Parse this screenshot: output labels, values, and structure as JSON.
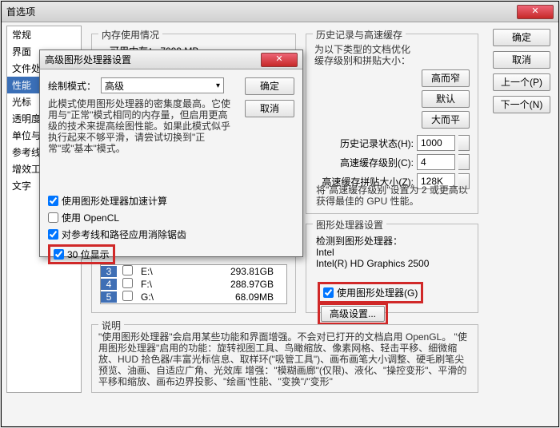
{
  "main": {
    "title": "首选项"
  },
  "sidebar": {
    "items": [
      {
        "label": "常规"
      },
      {
        "label": "界面"
      },
      {
        "label": "文件处…"
      },
      {
        "label": "性能",
        "selected": true
      },
      {
        "label": "光标"
      },
      {
        "label": "透明度…"
      },
      {
        "label": "单位与…"
      },
      {
        "label": "参考线…"
      },
      {
        "label": "增效工…"
      },
      {
        "label": "文字"
      }
    ]
  },
  "right_buttons": {
    "ok": "确定",
    "cancel": "取消",
    "prev": "上一个(P)",
    "next": "下一个(N)"
  },
  "memory": {
    "legend": "内存使用情况",
    "available_label": "可用内存：",
    "available_value": "7099 MB",
    "drives": [
      {
        "num": "3",
        "letter": "E:\\",
        "space": "293.81GB"
      },
      {
        "num": "4",
        "letter": "F:\\",
        "space": "288.97GB"
      },
      {
        "num": "5",
        "letter": "G:\\",
        "space": "68.09MB"
      }
    ]
  },
  "history": {
    "legend": "历史记录与高速缓存",
    "sub1": "为以下类型的文档优化",
    "sub2": "缓存级别和拼贴大小：",
    "btn_tall": "高而窄",
    "btn_default": "默认",
    "btn_flat": "大而平",
    "row1_label": "历史记录状态(H):",
    "row1_value": "1000",
    "row2_label": "高速缓存级别(C):",
    "row2_value": "4",
    "row3_label": "高速缓存拼贴大小(Z):",
    "row3_value": "128K",
    "note": "将\"高速缓存级别\"设置为 2 或更高以获得最佳的 GPU 性能。"
  },
  "gpu": {
    "legend": "图形处理器设置",
    "detected_label": "检测到图形处理器：",
    "vendor": "Intel",
    "model": "Intel(R) HD Graphics 2500",
    "use_gpu": "使用图形处理器(G)",
    "advanced_btn": "高级设置..."
  },
  "desc": {
    "legend": "说明",
    "text": "\"使用图形处理器\"会启用某些功能和界面增强。不会对已打开的文档启用 OpenGL。\n\"使用图形处理器\"启用的功能：旋转视图工具、鸟瞰缩放、像素网格、轻击平移、细微缩放、HUD 拾色器/丰富光标信息、取样环(\"吸管工具\")、画布画笔大小调整、硬毛刷笔尖预览、油画、自适应广角、光效库\n增强：\"模糊画廊\"(仅限)、液化、\"操控变形\"、平滑的平移和缩放、画布边界投影、\"绘画\"性能、\"变换\"/\"变形\""
  },
  "modal": {
    "title": "高级图形处理器设置",
    "mode_label": "绘制模式：",
    "mode_value": "高级",
    "desc": "此模式使用图形处理器的密集度最高。它使用与\"正常\"模式相同的内存量，但启用更高级的技术来提高绘图性能。如果此模式似乎执行起来不够平滑，请尝试切换到\"正常\"或\"基本\"模式。",
    "cb1": "使用图形处理器加速计算",
    "cb2": "使用 OpenCL",
    "cb3": "对参考线和路径应用消除锯齿",
    "cb4": "30 位显示",
    "ok": "确定",
    "cancel": "取消"
  }
}
